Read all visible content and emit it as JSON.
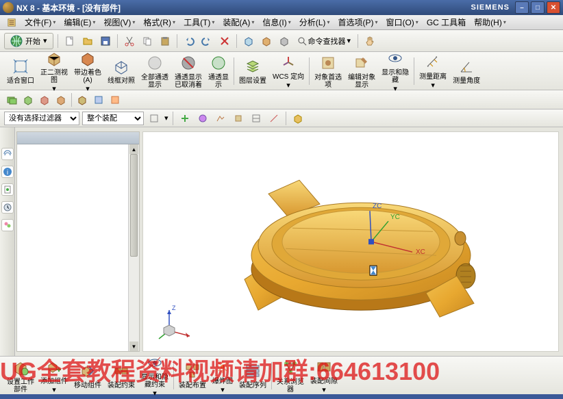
{
  "title": "NX 8 - 基本环境 - [没有部件]",
  "siemens": "SIEMENS",
  "menu": {
    "file": "文件(F)",
    "edit": "编辑(E)",
    "view": "视图(V)",
    "format": "格式(R)",
    "tools": "工具(T)",
    "assembly": "装配(A)",
    "info": "信息(I)",
    "analyze": "分析(L)",
    "pref": "首选项(P)",
    "window": "窗口(O)",
    "gc": "GC 工具箱",
    "help": "帮助(H)"
  },
  "start": "开始",
  "cmdfinder": "命令查找器",
  "bigtools": {
    "fitwin": "适合窗口",
    "ortho": "正二测视\n图",
    "edgecolor": "带边着色\n(A)",
    "wireframe": "线框对照",
    "allthru": "全部通透\n显示",
    "thrucancel": "通透显示\n已取消着",
    "thushow": "通透显\n示",
    "layerset": "图层设置",
    "wcs": "WCS 定向",
    "objpref": "对象首选\n项",
    "editobj": "编辑对象\n显示",
    "showhide": "显示和隐\n藏",
    "measdist": "测量距离",
    "measang": "测量角度"
  },
  "filters": {
    "no_select": "没有选择过滤器",
    "whole_asm": "整个装配"
  },
  "bottomtools": {
    "setwork": "设置工作\n部件",
    "addcomp": "添加组件",
    "movecomp": "移动组件",
    "asmconst": "装配约束",
    "showhide": "显示和隐\n藏约束",
    "asmarrange": "装配布置",
    "explode": "爆炸图",
    "asmseq": "装配序列",
    "relbrowse": "关系浏览\n器",
    "asmclear": "装配间隙"
  },
  "overlay": "UG全套教程资料视频请加群:664613100",
  "axes": {
    "x": "XC",
    "y": "YC",
    "z": "Z"
  }
}
